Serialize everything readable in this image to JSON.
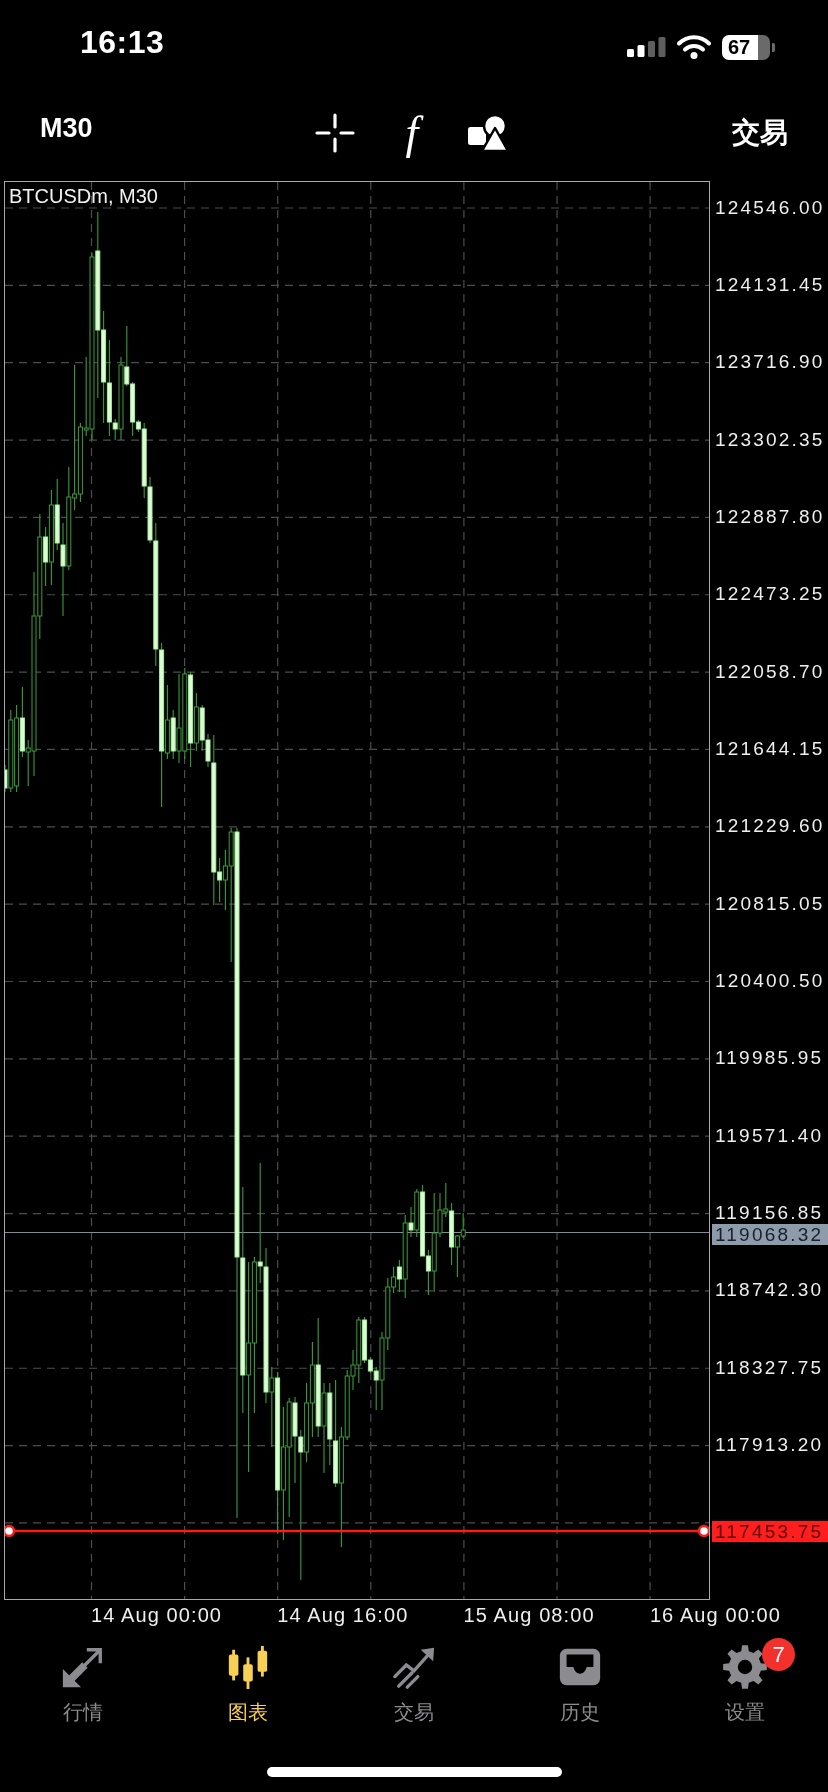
{
  "status_bar": {
    "time": "16:13",
    "battery": "67"
  },
  "toolbar": {
    "timeframe": "M30",
    "function_button": "f",
    "trade_button": "交易"
  },
  "chart": {
    "title": "BTCUSDm, M30",
    "price_labels": [
      "124546.00",
      "124131.45",
      "123716.90",
      "123302.35",
      "122887.80",
      "122473.25",
      "122058.70",
      "121644.15",
      "121229.60",
      "120815.05",
      "120400.50",
      "119985.95",
      "119571.40",
      "119156.85",
      "118742.30",
      "118327.75",
      "117913.20"
    ],
    "current_price": "119068.32",
    "order_price": "117453.75",
    "time_labels": [
      "14 Aug 00:00",
      "14 Aug 16:00",
      "15 Aug 08:00",
      "16 Aug 00:00"
    ]
  },
  "tab_bar": {
    "tabs": [
      {
        "label": "行情",
        "selected": false
      },
      {
        "label": "图表",
        "selected": true
      },
      {
        "label": "交易",
        "selected": false
      },
      {
        "label": "历史",
        "selected": false
      },
      {
        "label": "设置",
        "selected": false,
        "badge": "7"
      }
    ]
  }
}
